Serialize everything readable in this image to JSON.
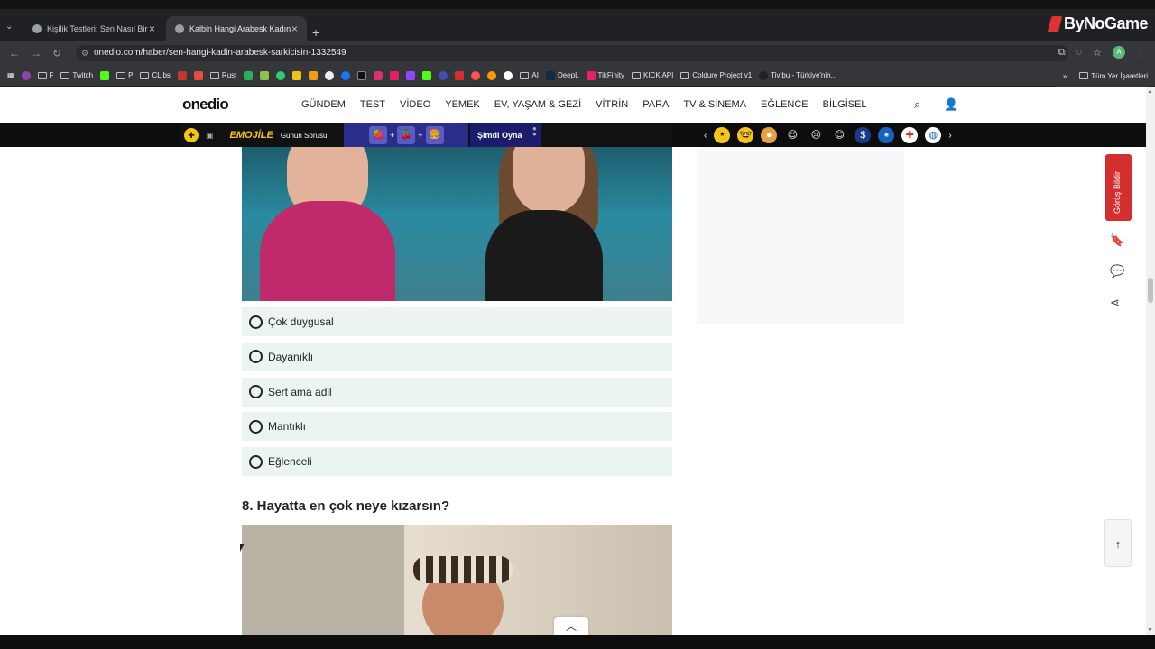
{
  "browser": {
    "tabs": [
      {
        "title": "Kişilik Testleri: Sen Nasıl Birisin?",
        "active": false
      },
      {
        "title": "Kalbin Hangi Arabesk Kadın Gi...",
        "active": true
      }
    ],
    "url": "onedio.com/haber/sen-hangi-kadin-arabesk-sarkicisin-1332549",
    "profile_initial": "A",
    "brand_overlay": "ByNoGame",
    "bookmarks": [
      "F",
      "Twitch",
      "P",
      "CLibs",
      "Rust",
      "AI",
      "DeepL",
      "TikFinity",
      "KICK API",
      "Coldure Project v1",
      "Tivibu - Türkiye'nin..."
    ],
    "bookmarks_all": "Tüm Yer İşaretleri",
    "bookmarks_more": "»"
  },
  "site": {
    "logo": "onedio",
    "nav": [
      "GÜNDEM",
      "TEST",
      "VİDEO",
      "YEMEK",
      "EV, YAŞAM & GEZİ",
      "VİTRİN",
      "PARA",
      "TV & SİNEMA",
      "EĞLENCE",
      "BİLGİSEL"
    ],
    "emoji_bar": {
      "logo": "EMOJİLE",
      "daily_question": "Günün Sorusu",
      "play_label": "Şimdi Oyna"
    },
    "feedback_label": "Görüş Bildir"
  },
  "quiz": {
    "options": [
      "Çok duygusal",
      "Dayanıklı",
      "Sert ama adil",
      "Mantıklı",
      "Eğlenceli"
    ],
    "next_question": "8. Hayatta en çok neye kızarsın?"
  },
  "colors": {
    "option_bg": "#eaf5ef",
    "feedback_bg": "#d32f2f",
    "emoji_game_bg": "#2b2d8a"
  }
}
